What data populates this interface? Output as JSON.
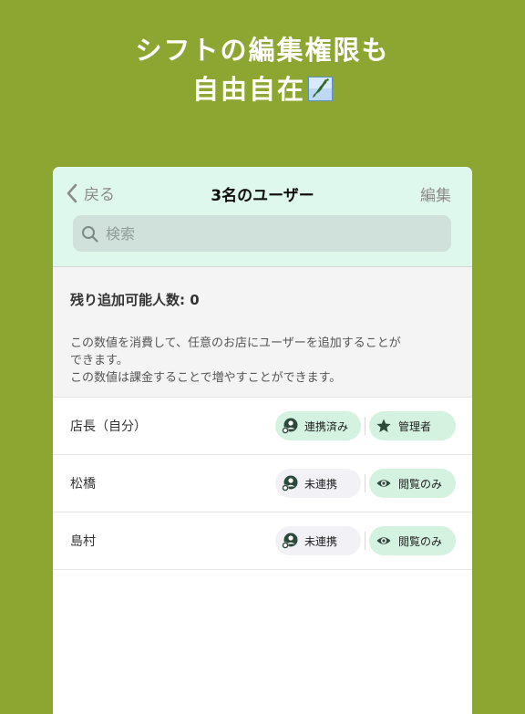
{
  "headline": {
    "line1": "シフトの編集権限も",
    "line2": "自由自在"
  },
  "nav": {
    "back_label": "戻る",
    "title": "3名のユーザー",
    "edit_label": "編集"
  },
  "search": {
    "placeholder": "検索"
  },
  "info": {
    "count_label": "残り追加可能人数: 0",
    "desc_line1": "この数値を消費して、任意のお店にユーザーを追加することが",
    "desc_line2": "できます。",
    "desc_line3": "この数値は課金することで増やすことができます。"
  },
  "users": [
    {
      "name": "店長（自分）",
      "link_status": "連携済み",
      "role": "管理者"
    },
    {
      "name": "松橋",
      "link_status": "未連携",
      "role": "閲覧のみ"
    },
    {
      "name": "島村",
      "link_status": "未連携",
      "role": "閲覧のみ"
    }
  ],
  "icons": {
    "back": "chevron-left-icon",
    "search": "magnifier-icon",
    "link": "user-link-icon",
    "admin": "star-icon",
    "view": "eye-icon",
    "map": "japan-map-emoji-icon"
  },
  "colors": {
    "background": "#8da632",
    "nav_background": "#dff8ee",
    "search_background": "#cfe1da",
    "linked_pill": "#d3f2df",
    "unlinked_pill": "#f1f1f6",
    "icon_dark": "#2b4a3a"
  }
}
